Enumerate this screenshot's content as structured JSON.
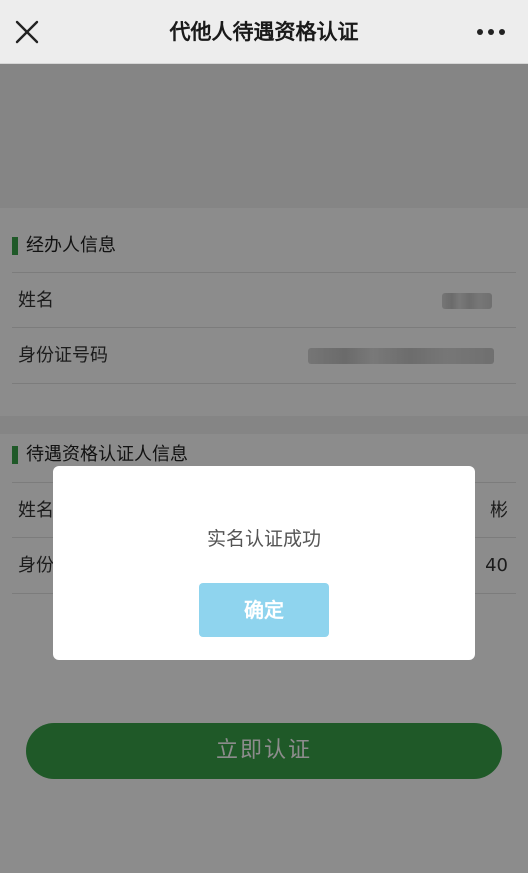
{
  "header": {
    "title": "代他人待遇资格认证",
    "close_icon": "close-icon",
    "more_icon": "more-horizontal-icon"
  },
  "agent_section": {
    "title": "经办人信息",
    "rows": [
      {
        "label": "姓名"
      },
      {
        "label": "身份证号码"
      }
    ]
  },
  "subject_section": {
    "title": "待遇资格认证人信息",
    "rows": [
      {
        "label": "姓名",
        "value_tail": "彬"
      },
      {
        "label": "身份证号码",
        "value_tail": "40"
      }
    ]
  },
  "submit": {
    "label": "立即认证"
  },
  "dialog": {
    "message": "实名认证成功",
    "confirm_label": "确定"
  },
  "colors": {
    "accent": "#3aa34a",
    "dialog_button": "#8fd4ee"
  }
}
